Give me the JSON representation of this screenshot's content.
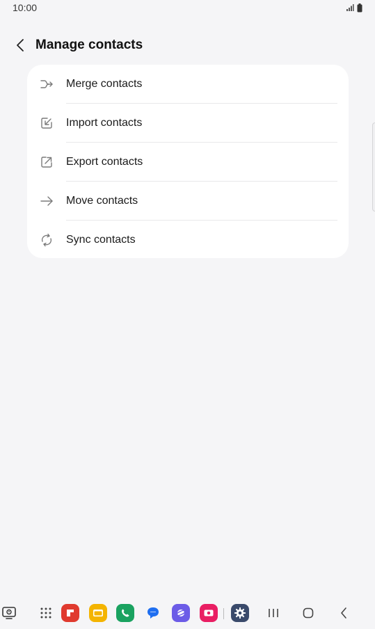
{
  "status_bar": {
    "time": "10:00"
  },
  "header": {
    "title": "Manage contacts"
  },
  "menu": {
    "items": [
      {
        "label": "Merge contacts",
        "icon": "merge-icon"
      },
      {
        "label": "Import contacts",
        "icon": "import-icon"
      },
      {
        "label": "Export contacts",
        "icon": "export-icon"
      },
      {
        "label": "Move contacts",
        "icon": "move-arrow-icon"
      },
      {
        "label": "Sync contacts",
        "icon": "sync-icon"
      }
    ]
  },
  "taskbar": {
    "apps": [
      {
        "name": "Flipboard",
        "color": "#e03a2f"
      },
      {
        "name": "My Files",
        "color": "#f4b400"
      },
      {
        "name": "Phone",
        "color": "#1aa260"
      },
      {
        "name": "Messages",
        "color": "#1e6ef0"
      },
      {
        "name": "Internet",
        "color": "#6c5ce7"
      },
      {
        "name": "Screen Recorder",
        "color": "#e91e63"
      },
      {
        "name": "Settings",
        "color": "#3a4a6b"
      }
    ]
  },
  "colors": {
    "background": "#f5f5f7",
    "card": "#ffffff",
    "icon_gray": "#7a7a7a"
  }
}
